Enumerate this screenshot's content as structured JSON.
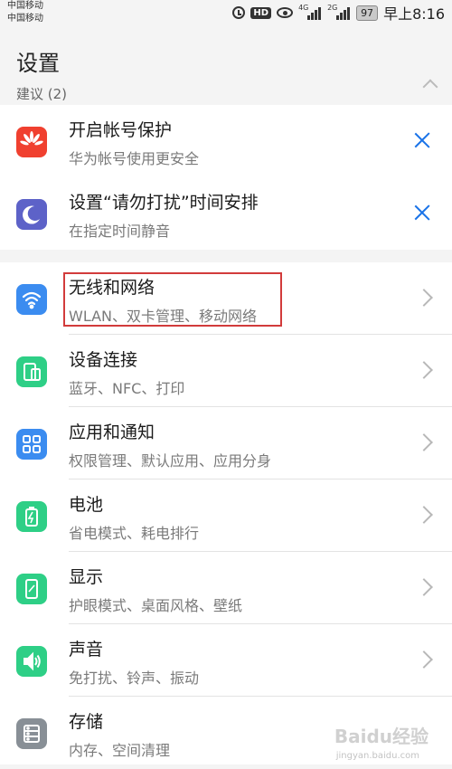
{
  "status_bar": {
    "carrier_1": "中国移动",
    "carrier_2": "中国移动",
    "hd_label": "HD",
    "net_1": "4G",
    "net_2": "2G",
    "battery": "97",
    "time": "早上8:16"
  },
  "header": {
    "title": "设置"
  },
  "suggestions": {
    "label": "建议 (2)",
    "items": [
      {
        "title": "开启帐号保护",
        "subtitle": "华为帐号使用更安全",
        "icon": "huawei-logo-icon"
      },
      {
        "title": "设置“请勿打扰”时间安排",
        "subtitle": "在指定时间静音",
        "icon": "moon-icon"
      }
    ]
  },
  "settings": {
    "items": [
      {
        "title": "无线和网络",
        "subtitle": "WLAN、双卡管理、移动网络",
        "icon": "wifi-icon"
      },
      {
        "title": "设备连接",
        "subtitle": "蓝牙、NFC、打印",
        "icon": "device-connection-icon"
      },
      {
        "title": "应用和通知",
        "subtitle": "权限管理、默认应用、应用分身",
        "icon": "apps-grid-icon"
      },
      {
        "title": "电池",
        "subtitle": "省电模式、耗电排行",
        "icon": "battery-icon"
      },
      {
        "title": "显示",
        "subtitle": "护眼模式、桌面风格、壁纸",
        "icon": "display-icon"
      },
      {
        "title": "声音",
        "subtitle": "免打扰、铃声、振动",
        "icon": "speaker-icon"
      },
      {
        "title": "存储",
        "subtitle": "内存、空间清理",
        "icon": "storage-icon"
      }
    ]
  },
  "watermark": {
    "text": "Baidu经验",
    "url": "jingyan.baidu.com"
  },
  "colors": {
    "accent": "#1a73e8",
    "highlight": "#d23b3b"
  }
}
